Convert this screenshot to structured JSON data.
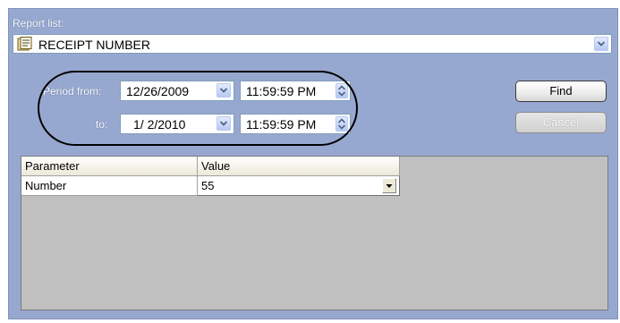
{
  "report_list": {
    "label": "Report list:",
    "selected": "RECEIPT NUMBER",
    "icon": "report-document-icon"
  },
  "period": {
    "from_label": "Period from:",
    "to_label": "to:",
    "from_date": "12/26/2009",
    "from_time": "11:59:59 PM",
    "to_date": "1/ 2/2010",
    "to_time": "11:59:59 PM"
  },
  "buttons": {
    "find": "Find",
    "cancel": "Cancel"
  },
  "table": {
    "headers": [
      "Parameter",
      "Value"
    ],
    "rows": [
      {
        "parameter": "Number",
        "value": "55"
      }
    ]
  },
  "colors": {
    "panel_bg": "#97a8d0",
    "grid_bg": "#c0c0c0"
  }
}
